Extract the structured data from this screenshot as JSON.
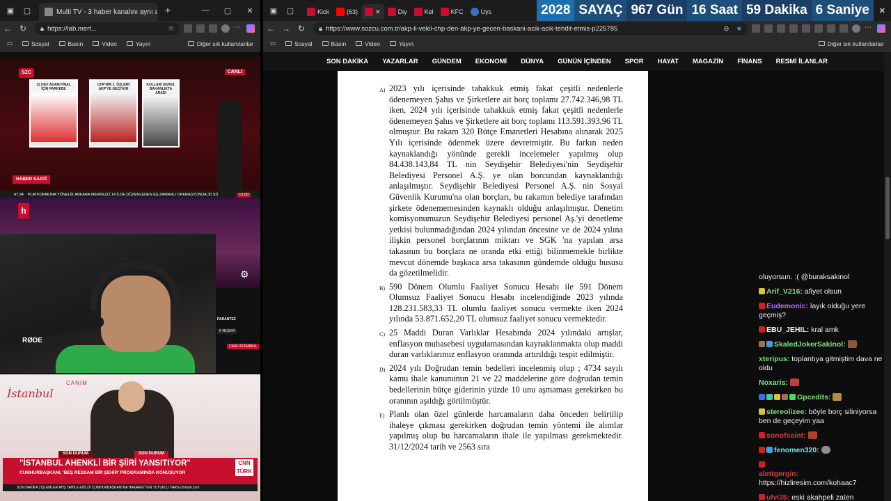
{
  "left_window": {
    "tab_title": "Multi TV - 3 haber kanalını aynı a",
    "url": "https://lab.mert...",
    "bookmarks": [
      "Sosyal",
      "Basın",
      "Video",
      "Yayın"
    ],
    "bookmarks_right": "Diğer sık kullanılanlar",
    "szc": {
      "logo": "SZC",
      "live": "CANLI",
      "panels": [
        "12 DEV ADAM FİNAL İÇİN PARKEDE",
        "CHP'NİN 2. ÖZLEMİ AKP'YE GEÇİYOR",
        "KOLLARI SIVADI, BAKANLIKTA ARADI"
      ],
      "show": "HABER SAATİ",
      "ticker_value": "47.34",
      "ticker_text": "PLATFORMUNA YÖNELİK ANKARA MERKEZLİ 14 İLDE DÜZENLENEN EŞ ZAMANLI OPERASYONDA 30 ŞÜ",
      "ticker_time": "15:00"
    },
    "halk": {
      "logo": "h",
      "parantez": "PARANTEZ",
      "stat": "€ 48.5344",
      "live": "CANLI İSTANBUL"
    },
    "webcam": {
      "mic_brand": "RØDE"
    },
    "cnn": {
      "canim": "CANIM",
      "istanbul": "İstanbul",
      "son_durum_1": "SON DURUM",
      "son_durum_2": "SON DURUM",
      "headline": "\"İSTANBUL AHENKLİ BİR ŞİİRİ YANSITIYOR\"",
      "subline": "CUMHURBAŞKANI, 'BEŞ RESSAM BİR ŞEHİR' PROGRAMINDA KONUŞUYOR",
      "logo_top": "CNN",
      "logo_bottom": "TÜRK",
      "ticker": "SON DAKİKA | İŞLEMLER AHŞ TAHİLE EDİLDİ  CUMHURBAŞKANI'NA HAKARETTEN TUTUKLU YARG cnnturk.com"
    }
  },
  "right_window": {
    "tabs": [
      "Kick",
      "(63)",
      "",
      "Diy",
      "Kel",
      "KFC",
      "Uys"
    ],
    "url": "https://www.sozcu.com.tr/akp-li-vekil-chp-den-akp-ye-gecen-baskani-acik-acik-tehdit-etmis-p225785",
    "counter": {
      "year": "2028",
      "label": "SAYAÇ",
      "days": "967 Gün",
      "hours": "16 Saat",
      "minutes": "59 Dakika",
      "seconds": "6 Saniye"
    },
    "bookmarks": [
      "Sosyal",
      "Basın",
      "Video",
      "Yayın"
    ],
    "bookmarks_right": "Diğer sık kullanılanlar",
    "site_nav": [
      "SON DAKİKA",
      "YAZARLAR",
      "GÜNDEM",
      "EKONOMİ",
      "DÜNYA",
      "GÜNÜN İÇİNDEN",
      "SPOR",
      "HAYAT",
      "MAGAZİN",
      "FİNANS",
      "RESMİ İLANLAR"
    ],
    "document": [
      {
        "label": "A)",
        "text": "2023 yılı içerisinde tahakkuk etmiş fakat çeşitli nedenlerle ödenemeyen Şahıs ve Şirketlere ait borç toplamı 27.742.346,98 TL iken, 2024 yılı içerisinde tahakkuk etmiş fakat çeşitli nedenlerle ödenemeyen Şahıs ve Şirketlere ait borç toplamı 113.591.393,96 TL olmuştur. Bu rakam 320 Bütçe Emanetleri Hesabına alınarak 2025 Yılı içerisinde ödenmek üzere devretmiştir. Bu farkın neden kaynaklandığı yönünde gerekli incelemeler yapılmış olup 84.438.143,84 TL nin Seydişehir Belediyesi'nin Seydişehir Belediyesi Personel A.Ş. ye olan borcundan kaynaklandığı anlaşılmıştır. Seydişehir Belediyesi Personel A.Ş. nin Sosyal Güvenlik Kurumu'na olan borçları, bu rakamın belediye tarafından şirkete ödenememesinden kaynaklı olduğu anlaşılmıştır. Denetim komisyonumuzun Seydişehir Belediyesi personel Aş.'yi denetleme yetkisi bulunmadığından 2024 yılından öncesine ve de 2024 yılına ilişkin personel borçlarının miktarı ve SGK 'na yapılan arsa takasının bu borçlara ne oranda etki ettiği bilinmemekle birlikte mevcut dönemde başkaca arsa takasının gündemde olduğu hususu da gözetilmelidir."
      },
      {
        "label": "B)",
        "text": "590 Dönem Olumlu Faaliyet Sonucu Hesabı ile 591 Dönem Olumsuz Faaliyet Sonucu Hesabı incelendiğinde 2023 yılında 128.231.583,33 TL olumlu faaliyet sonucu vermekte iken 2024 yılında 53.871.652,20 TL olumsuz faaliyet sonucu vermektedir."
      },
      {
        "label": "C)",
        "text": "25 Maddi Duran Varlıklar Hesabında 2024 yılındaki artışlar, enflasyon muhasebesi uygulamasından kaynaklanmakta olup maddi duran varlıklarımız enflasyon oranında artırıldığı tespit edilmiştir."
      },
      {
        "label": "D)",
        "text": "2024 yılı Doğrudan temin bedelleri incelenmiş olup ; 4734 sayılı kamu ihale kanununun 21 ve 22 maddelerine göre doğrudan temin bedellerinin bütçe giderinin yüzde 10 unu aşmaması gerekirken bu oranının aşıldığı görülmüştür."
      },
      {
        "label": "E)",
        "text": "Planlı olan özel günlerde harcamaların daha önceden belirtilip ihaleye çıkması gerekirken doğrudan temin yöntemi ile alımlar yapılmış olup bu harcamaların ihale ile yapılması gerekmektedir. 31/12/2024 tarih ve 2563 sıra"
      }
    ],
    "chat": [
      {
        "user": "",
        "text": "oluyorsun. :( @buraksakinol",
        "color": "#f0f0f0"
      },
      {
        "user": "Arif_V216:",
        "text": "afiyet olsun",
        "color": "#7ee07e"
      },
      {
        "user": "Eudemonic:",
        "text": "layık olduğu yere geçmiş?",
        "color": "#b36bff"
      },
      {
        "user": "EBU_JEHIL:",
        "text": "kral amk",
        "color": "#e0e0e0"
      },
      {
        "user": "SkaledJokerSakinol:",
        "text": "",
        "color": "#7ee07e"
      },
      {
        "user": "xteripus:",
        "text": "toplantıya gitmiştim dava ne oldu",
        "color": "#7ee07e"
      },
      {
        "user": "Noxaris:",
        "text": "",
        "color": "#7ee07e"
      },
      {
        "user": "Gpcedits:",
        "text": "",
        "color": "#7ee07e"
      },
      {
        "user": "stereolizee:",
        "text": "böyle borç siliniyorsa ben de geçeyim yaa",
        "color": "#7ee07e"
      },
      {
        "user": "sonofsaint:",
        "text": "",
        "color": "#d04040"
      },
      {
        "user": "fenomen320:",
        "text": "",
        "color": "#7ee0e0"
      },
      {
        "user": "alettgergin:",
        "text": "https://hizliresim.com/kohaac7",
        "color": "#d04040"
      },
      {
        "user": "ulvi35:",
        "text": "eski akahpeli zaten",
        "color": "#d04040"
      }
    ]
  }
}
